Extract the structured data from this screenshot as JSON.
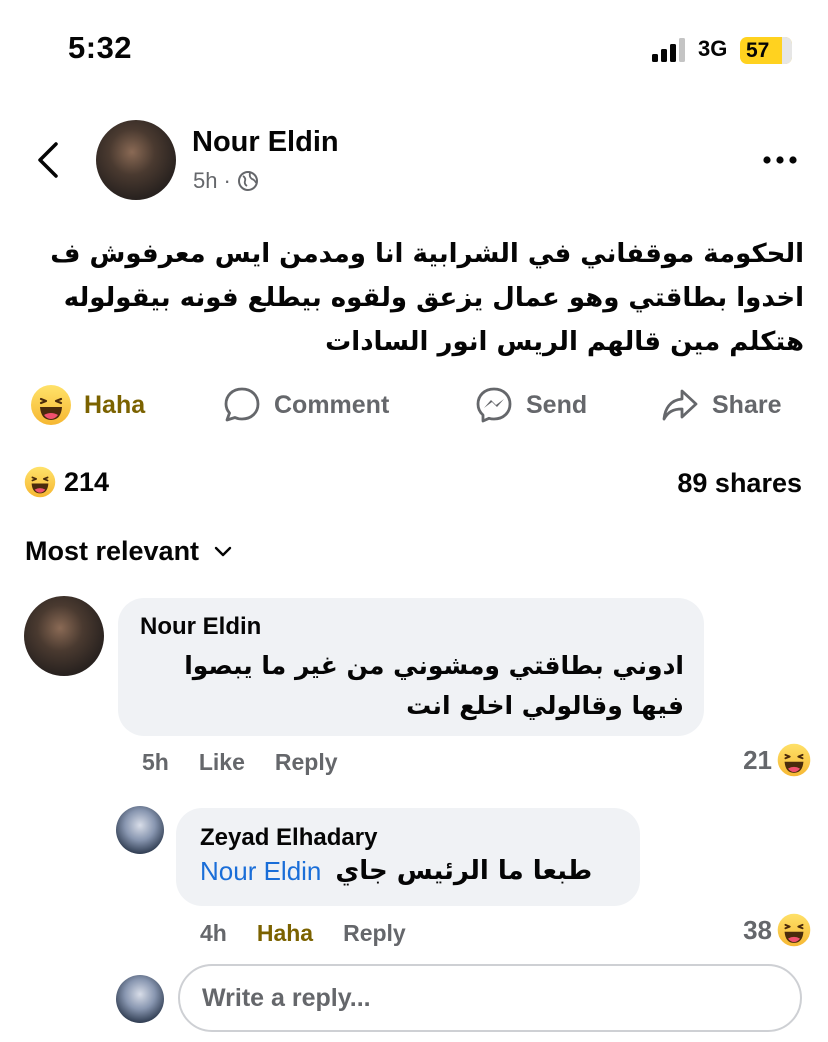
{
  "status_bar": {
    "time": "5:32",
    "network": "3G",
    "battery": "57"
  },
  "post": {
    "author": "Nour Eldin",
    "time": "5h",
    "text": "الحكومة موقفاني في الشرابية انا ومدمن ايس معرفوش ف اخدوا بطاقتي وهو عمال يزعق ولقوه بيطلع فونه بيقولوله هتكلم مين قالهم الريس انور السادات"
  },
  "actions": {
    "haha": "Haha",
    "comment": "Comment",
    "send": "Send",
    "share": "Share"
  },
  "stats": {
    "reactions": "214",
    "shares": "89 shares"
  },
  "sort_label": "Most relevant",
  "comments": [
    {
      "author": "Nour Eldin",
      "text": "ادوني بطاقتي ومشوني من غير ما يبصوا فيها وقالولي اخلع انت",
      "time": "5h",
      "like": "Like",
      "reply": "Reply",
      "reactions": "21"
    },
    {
      "author": "Zeyad Elhadary",
      "mention": "Nour Eldin",
      "text": "طبعا ما الرئيس جاي",
      "time": "4h",
      "like": "Haha",
      "reply": "Reply",
      "reactions": "38"
    }
  ],
  "reply_input": {
    "placeholder": "Write a reply..."
  },
  "colors": {
    "haha_active": "#7b6200",
    "mention": "#1a6ed8",
    "bubble": "#f0f2f5",
    "battery": "#ffd21f"
  }
}
